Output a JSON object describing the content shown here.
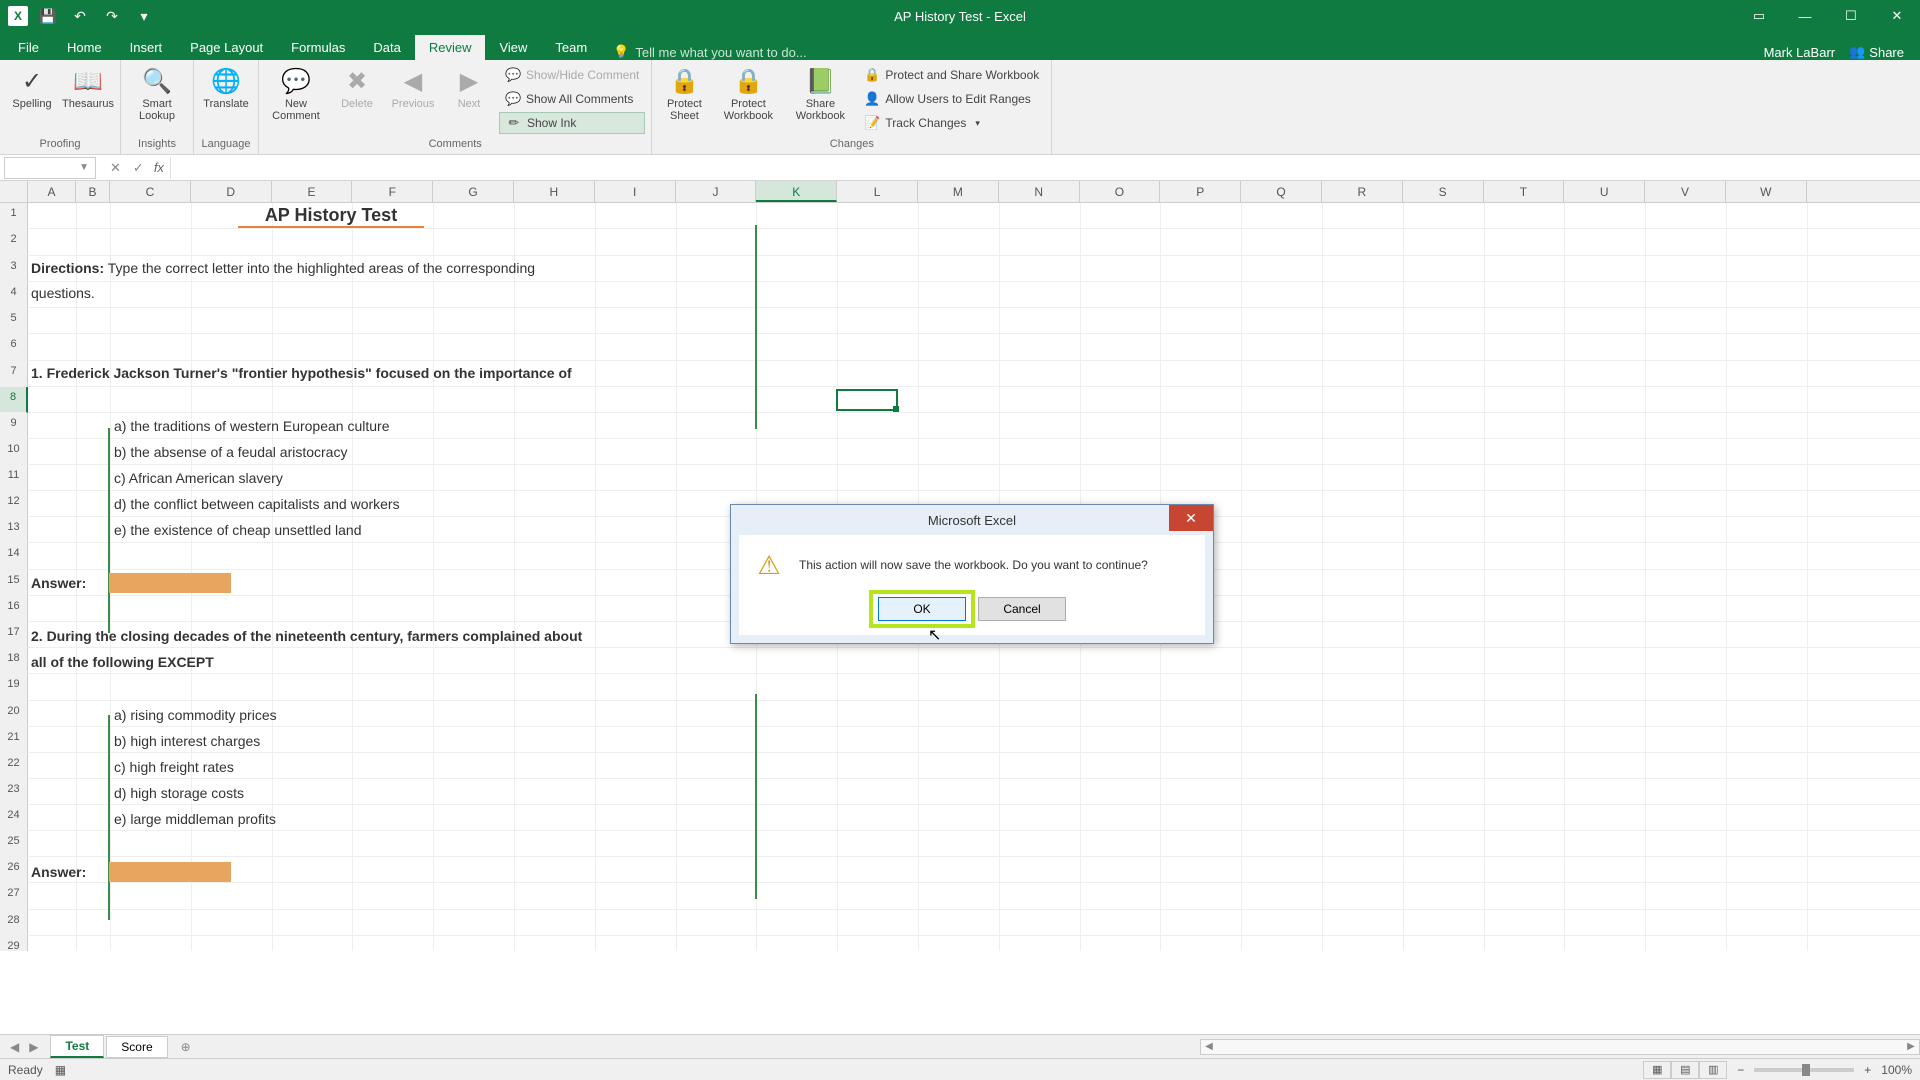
{
  "app": {
    "title": "AP History Test - Excel",
    "user": "Mark LaBarr",
    "share": "Share"
  },
  "qat": {
    "save": "💾",
    "undo": "↶",
    "redo": "↷"
  },
  "tabs": {
    "file": "File",
    "home": "Home",
    "insert": "Insert",
    "page_layout": "Page Layout",
    "formulas": "Formulas",
    "data": "Data",
    "review": "Review",
    "view": "View",
    "team": "Team",
    "tellme": "Tell me what you want to do..."
  },
  "ribbon": {
    "proofing": {
      "label": "Proofing",
      "spelling": "Spelling",
      "thesaurus": "Thesaurus"
    },
    "insights": {
      "label": "Insights",
      "smart": "Smart Lookup"
    },
    "language": {
      "label": "Language",
      "translate": "Translate"
    },
    "comments": {
      "label": "Comments",
      "new": "New Comment",
      "delete": "Delete",
      "previous": "Previous",
      "next": "Next",
      "showhide": "Show/Hide Comment",
      "showall": "Show All Comments",
      "showink": "Show Ink"
    },
    "changes": {
      "label": "Changes",
      "protect_sheet": "Protect Sheet",
      "protect_wb": "Protect Workbook",
      "share_wb": "Share Workbook",
      "protect_share": "Protect and Share Workbook",
      "allow_edit": "Allow Users to Edit Ranges",
      "track": "Track Changes"
    }
  },
  "namebox": "",
  "columns": [
    "A",
    "B",
    "C",
    "D",
    "E",
    "F",
    "G",
    "H",
    "I",
    "J",
    "K",
    "L",
    "M",
    "N",
    "O",
    "P",
    "Q",
    "R",
    "S",
    "T",
    "U",
    "V",
    "W"
  ],
  "selected_col": "K",
  "selected_row": "8",
  "sheet": {
    "title": "AP History Test",
    "directions_label": "Directions:",
    "directions_text": "Type the correct letter into the highlighted areas of the corresponding",
    "directions_text2": "questions.",
    "q1": "1. Frederick Jackson Turner's \"frontier hypothesis\" focused on the importance of",
    "q1a": "a) the traditions of western European culture",
    "q1b": "b) the absense of a feudal aristocracy",
    "q1c": "c) African American slavery",
    "q1d": "d) the conflict between capitalists and workers",
    "q1e": "e) the existence of cheap unsettled land",
    "answer_label": "Answer:",
    "q2": "2. During the closing decades of the nineteenth century, farmers complained about",
    "q2b": "all of the following EXCEPT",
    "q2aa": "a) rising commodity prices",
    "q2ab": "b) high interest charges",
    "q2ac": "c) high freight rates",
    "q2ad": "d) high storage costs",
    "q2ae": "e) large middleman profits"
  },
  "sheet_tabs": {
    "test": "Test",
    "score": "Score"
  },
  "dialog": {
    "title": "Microsoft Excel",
    "message": "This action will now save the workbook. Do you want to continue?",
    "ok": "OK",
    "cancel": "Cancel"
  },
  "status": {
    "ready": "Ready",
    "zoom": "100%"
  }
}
